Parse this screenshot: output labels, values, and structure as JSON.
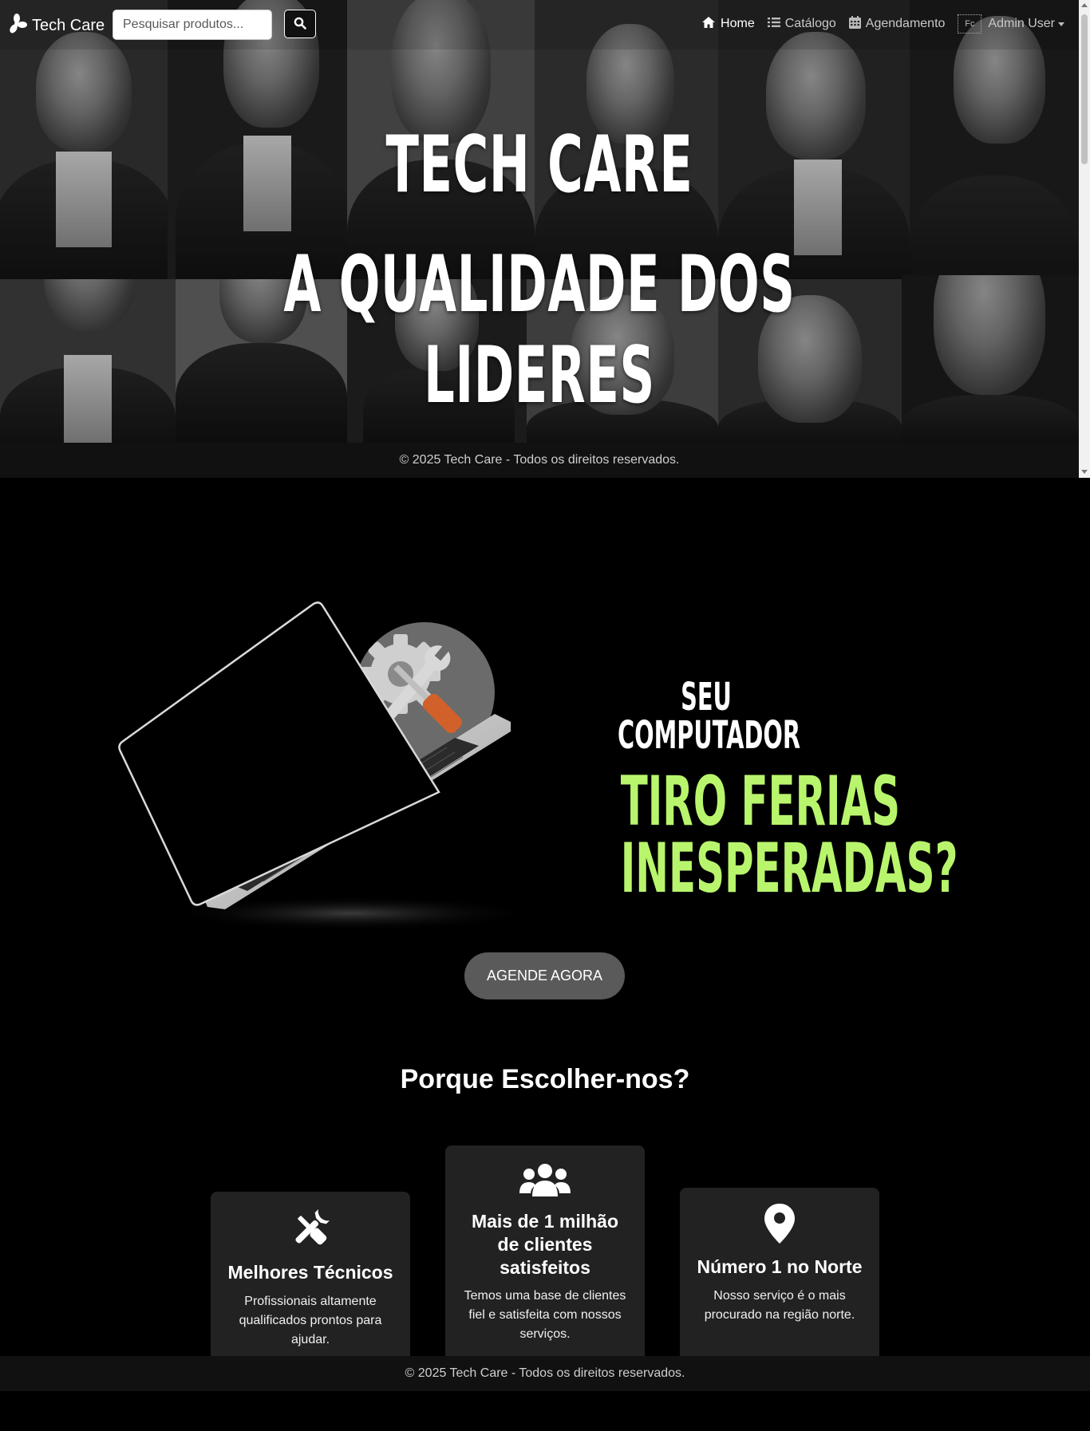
{
  "navbar": {
    "brand": "Tech Care",
    "search_placeholder": "Pesquisar produtos...",
    "links": [
      {
        "label": "Home",
        "icon": "home-icon",
        "active": true
      },
      {
        "label": "Catálogo",
        "icon": "list-icon",
        "active": false
      },
      {
        "label": "Agendamento",
        "icon": "calendar-icon",
        "active": false
      }
    ],
    "avatar_alt": "Fc",
    "user_name": "Admin User"
  },
  "hero": {
    "title": "TECH CARE",
    "subtitle": "A QUALIDADE DOS LIDERES"
  },
  "hero_footer": "© 2025 Tech Care - Todos os direitos reservados.",
  "promo": {
    "line1": "SEU COMPUTADOR",
    "line2": "TIRO FERIAS",
    "line3": "INESPERADAS?",
    "cta": "AGENDE AGORA",
    "accent_color": "#b8f56d"
  },
  "why": {
    "title": "Porque Escolher-nos?",
    "cards": [
      {
        "icon": "tools-icon",
        "title": "Melhores Técnicos",
        "text": "Profissionais altamente qualificados prontos para ajudar."
      },
      {
        "icon": "users-icon",
        "title": "Mais de 1 milhão de clientes satisfeitos",
        "text": "Temos uma base de clientes fiel e satisfeita com nossos serviços."
      },
      {
        "icon": "map-marker-icon",
        "title": "Número 1 no Norte",
        "text": "Nosso serviço é o mais procurado na região norte."
      }
    ]
  },
  "footer": "© 2025 Tech Care - Todos os direitos reservados."
}
